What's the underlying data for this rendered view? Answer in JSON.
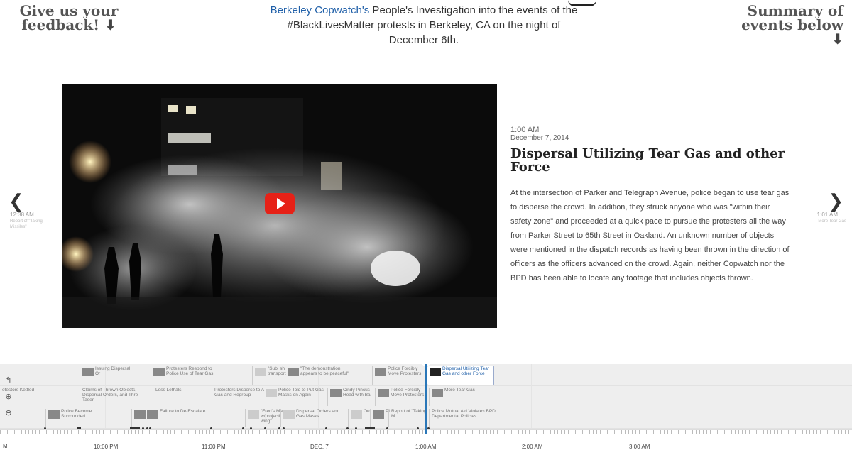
{
  "header": {
    "feedback_title": "Give us your feedback!",
    "feedback_arrow": "⬇",
    "summary_title": "Summary of events below",
    "summary_arrow": "⬇",
    "org_link": "Berkeley Copwatch's",
    "headline_rest": " People's Investigation into the events of the #BlackLivesMatter protests in Berkeley, CA on the night of December 6th."
  },
  "event": {
    "time": "1:00 AM",
    "date": "December 7, 2014",
    "title": "Dispersal Utilizing Tear Gas and other Force",
    "description": "At the intersection of Parker and Telegraph Avenue, police began to use tear gas to disperse the crowd. In addition, they struck anyone who was \"within their safety zone\" and proceeded at a quick pace to pursue the protesters all the way from Parker Street to 65th Street in Oakland. An unknown number of objects were mentioned in the dispatch records as having been thrown in the direction of officers as the officers advanced on the crowd. Again, neither Copwatch nor the BPD has been able to locate any footage that includes objects thrown."
  },
  "nav": {
    "prev_arrow": "❮",
    "prev_time": "12:38 AM",
    "prev_label": "Report of \"Taking Missiles\"",
    "next_arrow": "❯",
    "next_time": "1:01 AM",
    "next_label": "More Tear Gas"
  },
  "timeline": {
    "row1": [
      "Issuing Dispersal Or",
      "Protesters Respond to Police Use of Tear Gas",
      "\"Subj sh transport",
      "\"The demonstration appears to be peaceful\"",
      "Police Forcibly Move Protesters",
      "Dispersal Utilizing Tear Gas and other Force"
    ],
    "row2": [
      "otestors Kettled",
      "Claims of Thrown Objects, Dispersal Orders, and Thre Taser",
      "Less Lethals",
      "Protestors Disperse to A Gas and Regroup",
      "Police Told to Put Gas Masks on Again",
      "Cindy Pincus Head with Ba",
      "Police Forcibly Move Protesters",
      "More Tear Gas"
    ],
    "row3": [
      "Police Become Surrounded",
      "Failure to De-Escalate",
      "\"Fred's Ma w/projecti wing\"",
      "Dispersal Orders and Gas Masks",
      "Ord",
      "Pi",
      "Report of \"Taking M",
      "Police Mutual Aid Violates BPD Departmental Policies"
    ],
    "axis_labels": [
      "10:00 PM",
      "11:00 PM",
      "DEC. 7",
      "1:00 AM",
      "2:00 AM",
      "3:00 AM"
    ],
    "m_label": "M"
  },
  "controls": {
    "back_icon": "↰",
    "zoom_in_icon": "⊕",
    "zoom_out_icon": "⊖"
  }
}
